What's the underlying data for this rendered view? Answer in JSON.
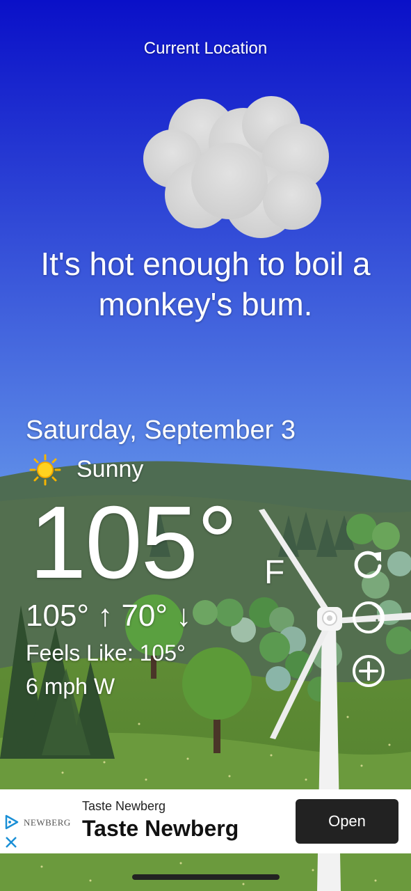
{
  "location": {
    "label": "Current Location"
  },
  "quip": {
    "text": "It's hot enough to boil a monkey's bum."
  },
  "weather": {
    "date": "Saturday, September 3",
    "condition_icon": "sun-icon",
    "condition": "Sunny",
    "temperature": "105°",
    "unit": "F",
    "high_low": "105° ↑  70° ↓",
    "feels_like": "Feels Like: 105°",
    "wind": "6 mph W"
  },
  "controls": {
    "refresh_icon": "refresh-icon",
    "moon_icon": "moon-icon",
    "add_icon": "plus-circle-icon"
  },
  "ad": {
    "logo_text": "NEWBERG",
    "small_title": "Taste Newberg",
    "title": "Taste Newberg",
    "open_label": "Open",
    "accent": "#1a8fd6"
  },
  "colors": {
    "sky_top": "#0a10c8",
    "sky_bottom": "#6fa2ee",
    "hills": "#4f6b50",
    "meadow": "#6a9a3a"
  }
}
